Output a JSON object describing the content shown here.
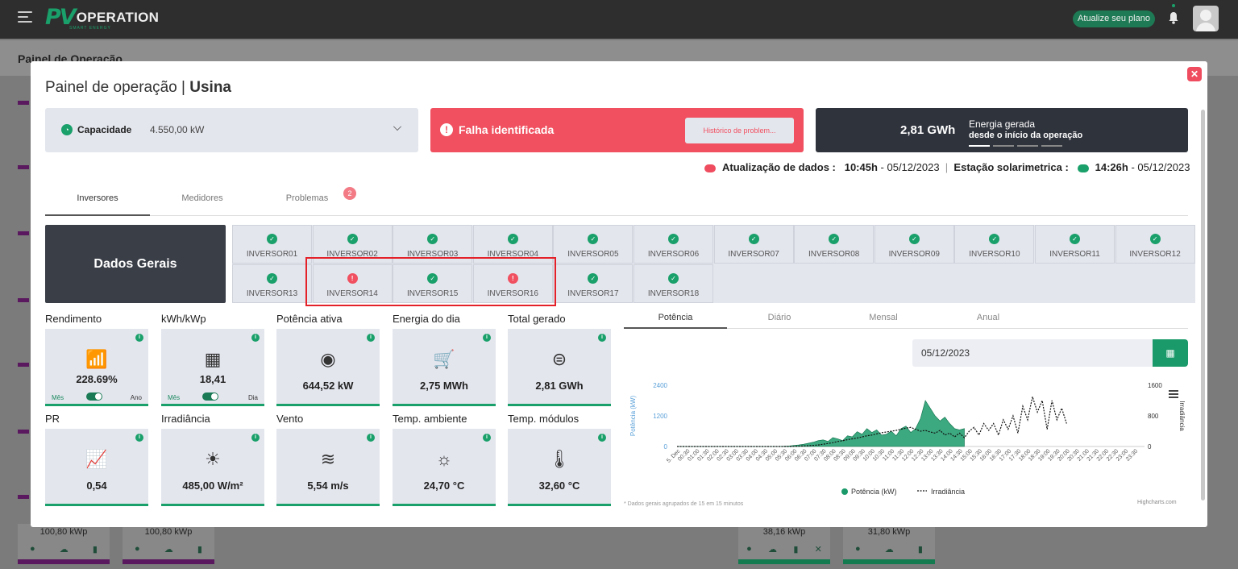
{
  "topbar": {
    "logo_pv": "PV",
    "logo_text": "OPERATION",
    "logo_sub": "SMART ENERGY",
    "upgrade_label": "Atualize seu plano"
  },
  "page": {
    "title": "Painel de Operação"
  },
  "background_cards": [
    {
      "label": "100,80 kWp"
    },
    {
      "label": "100,80 kWp"
    },
    {
      "label": "38,16 kWp"
    },
    {
      "label": "31,80 kWp"
    }
  ],
  "modal": {
    "title_prefix": "Painel de operação",
    "title_bold": "Usina",
    "capacity": {
      "label": "Capacidade",
      "value": "4.550,00 kW"
    },
    "failure": {
      "label": "Falha identificada",
      "history_button": "Histórico de problem..."
    },
    "energy": {
      "value": "2,81 GWh",
      "line1": "Energia gerada",
      "line2": "desde o início da operação"
    },
    "update": {
      "label": "Atualização de dados :",
      "time": "10:45h",
      "date": "- 05/12/2023",
      "sep": "|",
      "station_label": "Estação solarimetrica :",
      "station_time": "14:26h",
      "station_date": "- 05/12/2023"
    },
    "tabs": [
      {
        "label": "Inversores"
      },
      {
        "label": "Medidores"
      },
      {
        "label": "Problemas"
      }
    ],
    "problems_badge": "2",
    "dados_gerais": "Dados Gerais",
    "inverters": [
      {
        "name": "INVERSOR01",
        "status": "ok"
      },
      {
        "name": "INVERSOR02",
        "status": "ok"
      },
      {
        "name": "INVERSOR03",
        "status": "ok"
      },
      {
        "name": "INVERSOR04",
        "status": "ok"
      },
      {
        "name": "INVERSOR05",
        "status": "ok"
      },
      {
        "name": "INVERSOR06",
        "status": "ok"
      },
      {
        "name": "INVERSOR07",
        "status": "ok"
      },
      {
        "name": "INVERSOR08",
        "status": "ok"
      },
      {
        "name": "INVERSOR09",
        "status": "ok"
      },
      {
        "name": "INVERSOR10",
        "status": "ok"
      },
      {
        "name": "INVERSOR11",
        "status": "ok"
      },
      {
        "name": "INVERSOR12",
        "status": "ok"
      },
      {
        "name": "INVERSOR13",
        "status": "ok"
      },
      {
        "name": "INVERSOR14",
        "status": "fault"
      },
      {
        "name": "INVERSOR15",
        "status": "ok"
      },
      {
        "name": "INVERSOR16",
        "status": "fault"
      },
      {
        "name": "INVERSOR17",
        "status": "ok"
      },
      {
        "name": "INVERSOR18",
        "status": "ok"
      }
    ],
    "metrics": [
      {
        "label": "Rendimento",
        "value": "228.69%",
        "icon": "chart-bars-icon",
        "toggle": [
          "Mês",
          "Ano"
        ]
      },
      {
        "label": "kWh/kWp",
        "value": "18,41",
        "icon": "solar-panel-icon",
        "toggle": [
          "Mês",
          "Dia"
        ]
      },
      {
        "label": "Potência ativa",
        "value": "644,52 kW",
        "icon": "gauge-icon"
      },
      {
        "label": "Energia do dia",
        "value": "2,75 MWh",
        "icon": "cart-icon"
      },
      {
        "label": "Total gerado",
        "value": "2,81 GWh",
        "icon": "meter-icon"
      },
      {
        "label": "PR",
        "value": "0,54",
        "icon": "trend-icon"
      },
      {
        "label": "Irradiância",
        "value": "485,00 W/m²",
        "icon": "sun-icon"
      },
      {
        "label": "Vento",
        "value": "5,54 m/s",
        "icon": "wind-icon"
      },
      {
        "label": "Temp. ambiente",
        "value": "24,70 °C",
        "icon": "thermo-sun-icon"
      },
      {
        "label": "Temp. módulos",
        "value": "32,60 °C",
        "icon": "thermometer-icon"
      }
    ],
    "chart_tabs": [
      {
        "label": "Potência"
      },
      {
        "label": "Diário"
      },
      {
        "label": "Mensal"
      },
      {
        "label": "Anual"
      }
    ],
    "date_value": "05/12/2023",
    "note": "* Dados gerais agrupados de 15 em 15 minutos",
    "credit": "Highcharts.com"
  },
  "chart_data": {
    "type": "area",
    "ylabel": "Potência (kW)",
    "y2label": "Irradiância",
    "yticks": [
      0,
      1200,
      2400
    ],
    "y2ticks": [
      0,
      800,
      1600
    ],
    "ylim": [
      0,
      2400
    ],
    "y2lim": [
      0,
      1600
    ],
    "x_start_label": "5. Dec",
    "xticks": [
      "00:30",
      "01:00",
      "01:30",
      "02:00",
      "02:30",
      "03:00",
      "03:30",
      "04:00",
      "04:30",
      "05:00",
      "05:30",
      "06:00",
      "06:30",
      "07:00",
      "07:30",
      "08:00",
      "08:30",
      "09:00",
      "09:30",
      "10:00",
      "10:30",
      "11:00",
      "11:30",
      "12:00",
      "12:30",
      "13:00",
      "13:30",
      "14:00",
      "14:30",
      "15:00",
      "15:30",
      "16:00",
      "16:30",
      "17:00",
      "17:30",
      "18:00",
      "18:30",
      "19:00",
      "19:30",
      "20:00",
      "20:30",
      "21:00",
      "21:30",
      "22:00",
      "22:30",
      "23:00",
      "23:30"
    ],
    "series": [
      {
        "name": "Potência (kW)",
        "color": "#1a9a6a",
        "values": [
          0,
          0,
          0,
          0,
          0,
          0,
          0,
          0,
          0,
          0,
          0,
          0,
          0,
          0,
          0,
          0,
          0,
          0,
          0,
          0,
          0,
          0,
          10,
          20,
          40,
          60,
          90,
          130,
          170,
          230,
          260,
          200,
          350,
          300,
          230,
          420,
          380,
          580,
          480,
          700,
          550,
          650,
          450,
          480,
          600,
          420,
          700,
          800,
          550,
          700,
          1100,
          1800,
          1500,
          1200,
          1000,
          1150,
          900,
          700,
          650,
          700
        ]
      },
      {
        "name": "Irradiância",
        "color": "#111111",
        "values": [
          0,
          0,
          0,
          0,
          0,
          0,
          0,
          0,
          0,
          0,
          0,
          0,
          0,
          0,
          0,
          0,
          0,
          0,
          0,
          0,
          0,
          0,
          0,
          0,
          5,
          10,
          15,
          20,
          30,
          40,
          60,
          80,
          100,
          130,
          150,
          180,
          200,
          220,
          250,
          280,
          300,
          330,
          360,
          380,
          400,
          420,
          450,
          480,
          500,
          450,
          400,
          420,
          380,
          350,
          420,
          300,
          350,
          250,
          350,
          230,
          400,
          500,
          300,
          600,
          420,
          600,
          300,
          700,
          450,
          800,
          350,
          1050,
          700,
          1300,
          900,
          1200,
          450,
          1200,
          700,
          1000,
          600
        ]
      }
    ]
  }
}
